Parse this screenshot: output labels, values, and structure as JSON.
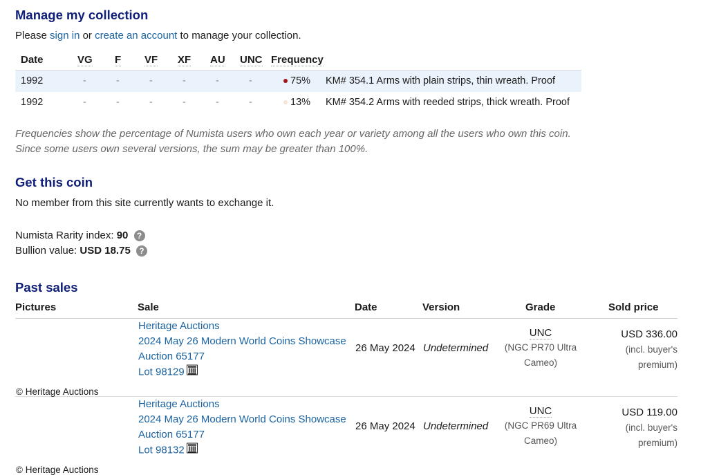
{
  "collection": {
    "title": "Manage my collection",
    "signin_prefix": "Please ",
    "signin_link": "sign in",
    "or_text": " or ",
    "create_link": "create an account",
    "suffix": " to manage your collection.",
    "headers": [
      "Date",
      "VG",
      "F",
      "VF",
      "XF",
      "AU",
      "UNC",
      "Frequency"
    ],
    "rows": [
      {
        "date": "1992",
        "vg": "-",
        "f": "-",
        "vf": "-",
        "xf": "-",
        "au": "-",
        "unc": "-",
        "freq": "75%",
        "freq_color": "#a01515",
        "desc": "KM# 354.1 Arms with plain strips, thin wreath. Proof"
      },
      {
        "date": "1992",
        "vg": "-",
        "f": "-",
        "vf": "-",
        "xf": "-",
        "au": "-",
        "unc": "-",
        "freq": "13%",
        "freq_color": "#f7e3d5",
        "desc": "KM# 354.2 Arms with reeded strips, thick wreath. Proof"
      }
    ],
    "note_line1": "Frequencies show the percentage of Numista users who own each year or variety among all the users who own this coin.",
    "note_line2": "Since some users own several versions, the sum may be greater than 100%."
  },
  "get_coin": {
    "title": "Get this coin",
    "text": "No member from this site currently wants to exchange it."
  },
  "rarity": {
    "label": "Numista Rarity index: ",
    "value": "90",
    "help": "?"
  },
  "bullion": {
    "label": "Bullion value: ",
    "value": "USD 18.75",
    "help": "?"
  },
  "past_sales": {
    "title": "Past sales",
    "headers": {
      "pictures": "Pictures",
      "sale": "Sale",
      "date": "Date",
      "version": "Version",
      "grade": "Grade",
      "price": "Sold price"
    },
    "rows": [
      {
        "house": "Heritage Auctions",
        "event": "2024 May 26 Modern World Coins Showcase",
        "auction": "Auction 65177",
        "lot": "Lot 98129",
        "date": "26 May 2024",
        "version": "Undetermined",
        "grade": "UNC",
        "grade_sub1": "(NGC PR70 Ultra",
        "grade_sub2": "Cameo)",
        "price": "USD 336.00",
        "price_sub1": "(incl. buyer's",
        "price_sub2": "premium)",
        "credit": "© Heritage Auctions"
      },
      {
        "house": "Heritage Auctions",
        "event": "2024 May 26 Modern World Coins Showcase",
        "auction": "Auction 65177",
        "lot": "Lot 98132",
        "date": "26 May 2024",
        "version": "Undetermined",
        "grade": "UNC",
        "grade_sub1": "(NGC PR69 Ultra",
        "grade_sub2": "Cameo)",
        "price": "USD 119.00",
        "price_sub1": "(incl. buyer's",
        "price_sub2": "premium)",
        "credit": "© Heritage Auctions"
      }
    ]
  }
}
